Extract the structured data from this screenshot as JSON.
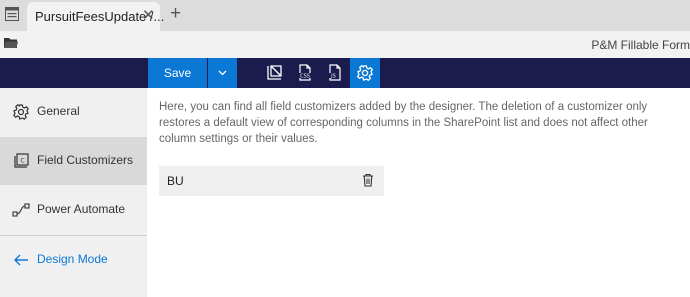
{
  "tabbar": {
    "tab_title": "PursuitFeesUpdate /...",
    "close_glyph": "✕",
    "new_tab_glyph": "+"
  },
  "header": {
    "document_title": "P&M Fillable Form"
  },
  "toolbar": {
    "save_label": "Save",
    "icons": [
      "layout-icon",
      "css-icon",
      "js-icon",
      "settings-gear-icon"
    ]
  },
  "sidebar": {
    "items": [
      {
        "label": "General",
        "icon": "gear-icon",
        "selected": false
      },
      {
        "label": "Field Customizers",
        "icon": "field-customizer-icon",
        "selected": true
      },
      {
        "label": "Power Automate",
        "icon": "flow-icon",
        "selected": false
      },
      {
        "label": "Design Mode",
        "icon": "arrow-left-icon",
        "selected": false
      }
    ]
  },
  "main": {
    "description": "Here, you can find all field customizers added by the designer. The deletion of a customizer only restores a default view of corresponding columns in the SharePoint list and does not affect other column settings or their values.",
    "customizers": [
      {
        "name": "BU"
      }
    ]
  },
  "colors": {
    "toolbar_bg": "#1b1b4e",
    "accent": "#0c78d6"
  }
}
